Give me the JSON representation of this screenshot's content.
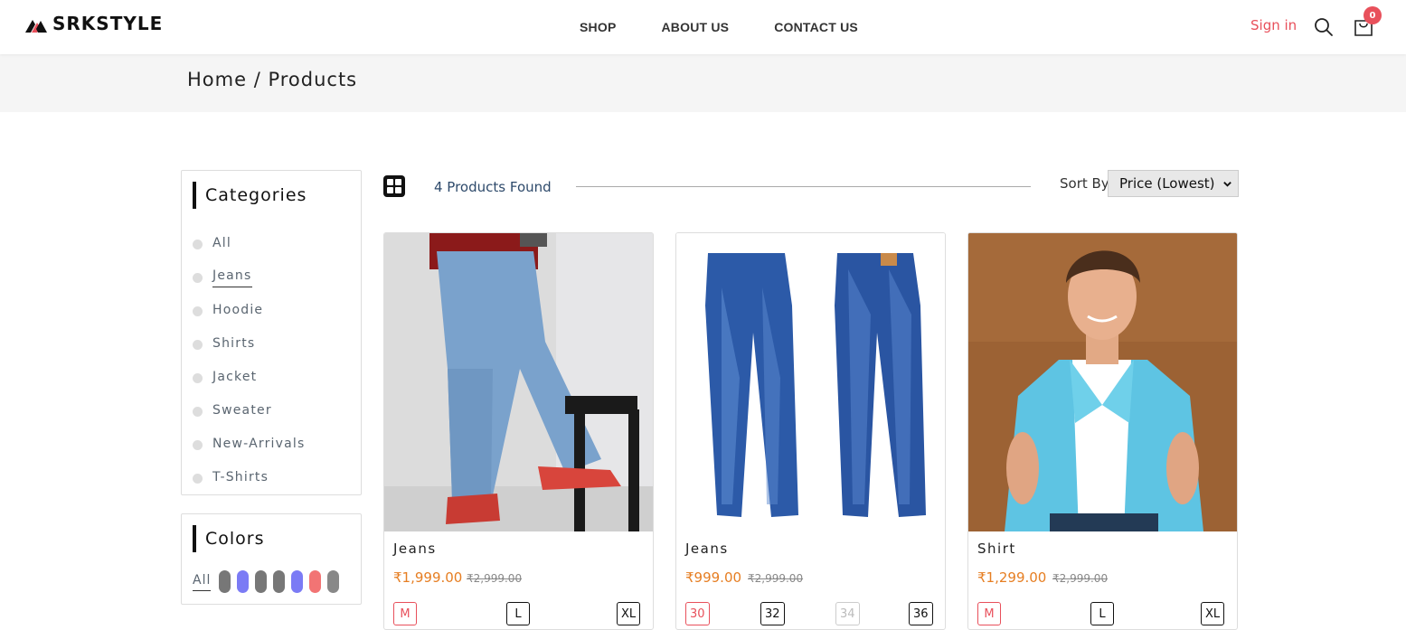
{
  "header": {
    "brand": "SRKSTYLE",
    "nav": [
      "SHOP",
      "ABOUT US",
      "CONTACT US"
    ],
    "signin": "Sign in",
    "cart_count": "0"
  },
  "breadcrumb": "Home / Products",
  "categories": {
    "title": "Categories",
    "items": [
      "All",
      "Jeans",
      "Hoodie",
      "Shirts",
      "Jacket",
      "Sweater",
      "New-Arrivals",
      "T-Shirts"
    ],
    "active": "Jeans"
  },
  "colors": {
    "title": "Colors",
    "all_label": "All",
    "swatches": [
      "#777777",
      "#7b7bf5",
      "#777777",
      "#777777",
      "#7b7bf5",
      "#f27474",
      "#888888"
    ]
  },
  "toolbar": {
    "found": "4 Products Found",
    "sort_label": "Sort By",
    "sort_value": "Price (Lowest)"
  },
  "products": [
    {
      "name": "Jeans",
      "price": "₹1,999.00",
      "mrp": "₹2,999.00",
      "sizes": [
        "M",
        "L",
        "XL"
      ]
    },
    {
      "name": "Jeans",
      "price": "₹999.00",
      "mrp": "₹2,999.00",
      "sizes": [
        "30",
        "32",
        "34",
        "36"
      ]
    },
    {
      "name": "Shirt",
      "price": "₹1,299.00",
      "mrp": "₹2,999.00",
      "sizes": [
        "M",
        "L",
        "XL"
      ]
    }
  ],
  "theme": {
    "accent": "#e8505b",
    "price": "#e67e22"
  }
}
